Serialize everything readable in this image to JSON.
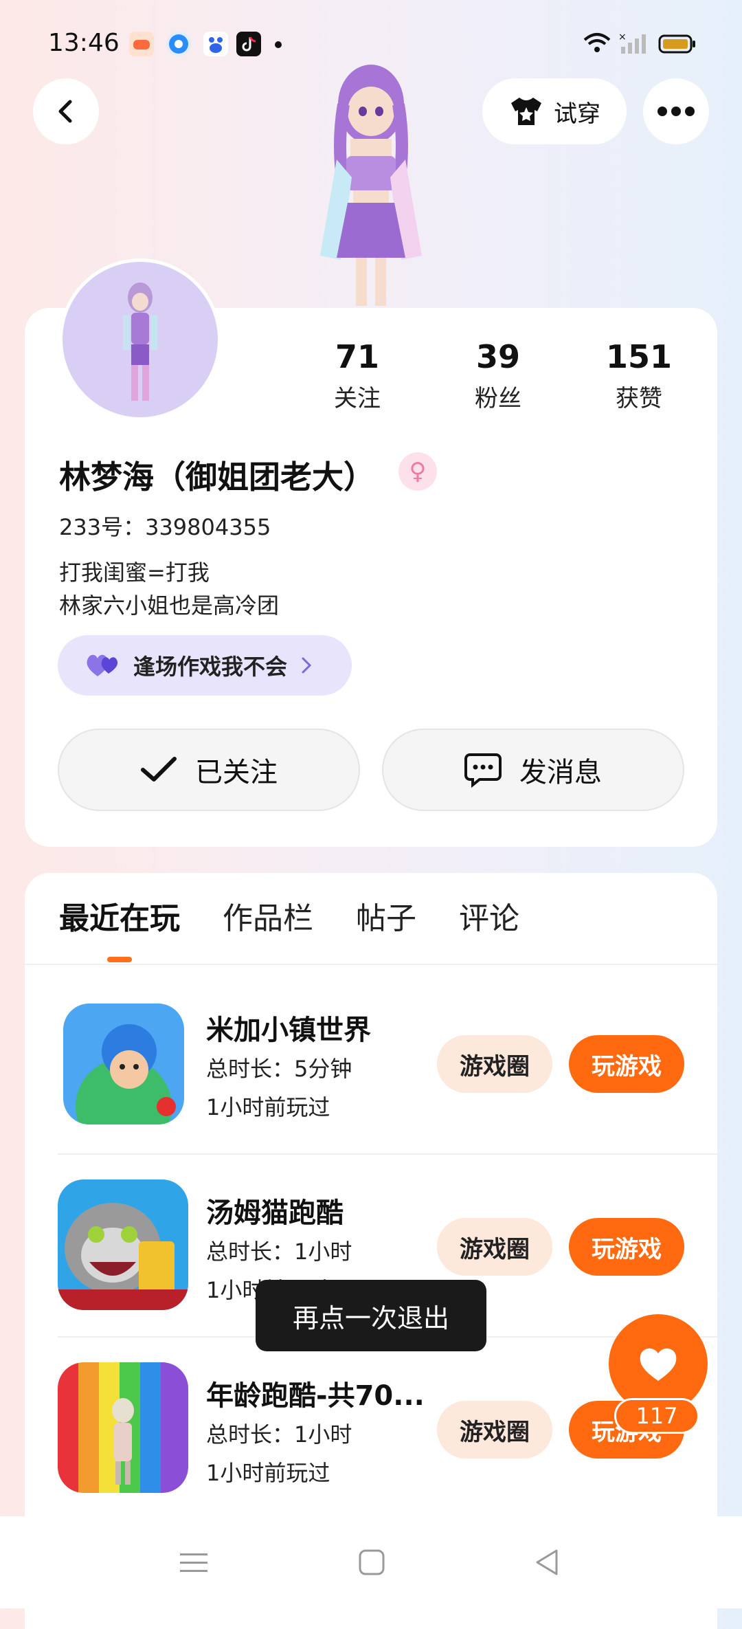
{
  "status_bar": {
    "time": "13:46",
    "app_icons": [
      "game-icon",
      "circle-app-icon",
      "baidu-icon",
      "tiktok-icon"
    ],
    "battery_color": "#d79b20"
  },
  "top_bar": {
    "try_on_label": "试穿"
  },
  "profile": {
    "stats": [
      {
        "count": "71",
        "label": "关注"
      },
      {
        "count": "39",
        "label": "粉丝"
      },
      {
        "count": "151",
        "label": "获赞"
      }
    ],
    "name": "林梦海（御姐团老大）",
    "gender_symbol": "♀",
    "uid": "233号：339804355",
    "bio_line1": "打我闺蜜=打我",
    "bio_line2": "林家六小姐也是高冷团",
    "tag_label": "逢场作戏我不会",
    "follow_label": "已关注",
    "message_label": "发消息"
  },
  "tabs": [
    {
      "label": "最近在玩",
      "active": true
    },
    {
      "label": "作品栏",
      "active": false
    },
    {
      "label": "帖子",
      "active": false
    },
    {
      "label": "评论",
      "active": false
    }
  ],
  "games": [
    {
      "title": "米加小镇世界",
      "duration": "总时长：5分钟",
      "last_played": "1小时前玩过",
      "circle_label": "游戏圈",
      "play_label": "玩游戏"
    },
    {
      "title": "汤姆猫跑酷",
      "duration": "总时长：1小时",
      "last_played": "1小时前玩过",
      "circle_label": "游戏圈",
      "play_label": "玩游戏"
    },
    {
      "title": "年龄跑酷-共70...",
      "duration": "总时长：1小时",
      "last_played": "1小时前玩过",
      "circle_label": "游戏圈",
      "play_label": "玩游戏"
    }
  ],
  "toast": "再点一次退出",
  "fab": {
    "count": "117"
  },
  "colors": {
    "accent": "#ff6a10",
    "light_accent": "#fde8dc",
    "tag_bg": "#e8e4fb"
  }
}
